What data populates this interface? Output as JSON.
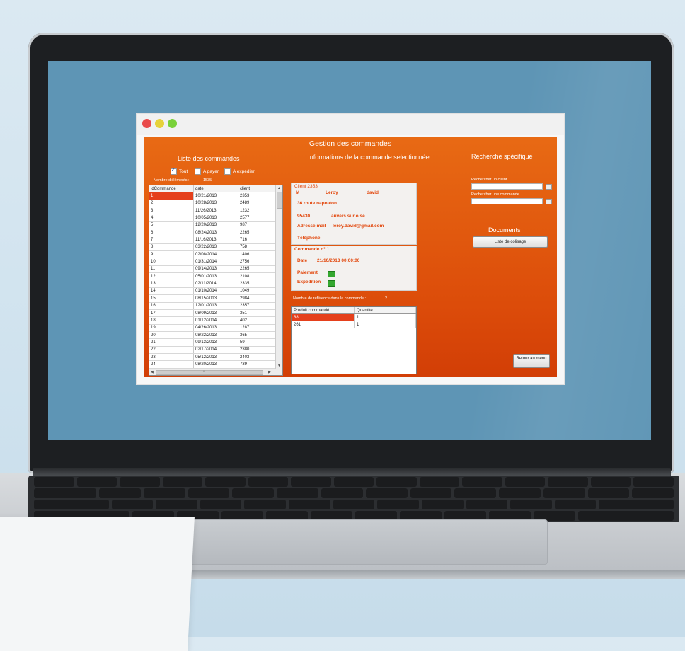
{
  "window": {
    "dots": [
      "#e94b4b",
      "#e6d23a",
      "#79d13a"
    ]
  },
  "app": {
    "title": "Gestion des commandes",
    "orders_section_title": "Liste des commandes",
    "info_section_title": "Informations de la commande selectionnée",
    "search_section_title": "Recherche spécifique",
    "filters": [
      {
        "label": "Tout",
        "checked": true
      },
      {
        "label": "A payer",
        "checked": false
      },
      {
        "label": "A expédier",
        "checked": false
      }
    ],
    "count_label": "Nombre d'éléments :",
    "count_value": "1535",
    "orders_table": {
      "columns": [
        "idCommande",
        "date",
        "client"
      ],
      "rows": [
        [
          "1",
          "10/21/2013",
          "2353"
        ],
        [
          "2",
          "10/28/2013",
          "2489"
        ],
        [
          "3",
          "11/26/2013",
          "1232"
        ],
        [
          "4",
          "10/05/2013",
          "2577"
        ],
        [
          "5",
          "12/20/2013",
          "987"
        ],
        [
          "6",
          "08/24/2013",
          "2265"
        ],
        [
          "7",
          "11/16/2013",
          "716"
        ],
        [
          "8",
          "03/22/2013",
          "758"
        ],
        [
          "9",
          "02/08/2014",
          "1406"
        ],
        [
          "10",
          "01/31/2014",
          "2756"
        ],
        [
          "11",
          "09/14/2013",
          "2265"
        ],
        [
          "12",
          "05/01/2013",
          "2108"
        ],
        [
          "13",
          "02/11/2014",
          "2335"
        ],
        [
          "14",
          "01/10/2014",
          "1049"
        ],
        [
          "15",
          "08/15/2013",
          "2984"
        ],
        [
          "16",
          "12/01/2013",
          "2357"
        ],
        [
          "17",
          "08/09/2013",
          "351"
        ],
        [
          "18",
          "01/12/2014",
          "402"
        ],
        [
          "19",
          "04/26/2013",
          "1287"
        ],
        [
          "20",
          "08/22/2013",
          "365"
        ],
        [
          "21",
          "09/13/2013",
          "59"
        ],
        [
          "22",
          "02/17/2014",
          "2380"
        ],
        [
          "23",
          "05/12/2013",
          "2403"
        ],
        [
          "24",
          "08/20/2013",
          "739"
        ]
      ],
      "selected_row": 0
    },
    "client_box": {
      "header": "Client 2353",
      "civility": "M",
      "last_name": "Leroy",
      "first_name": "david",
      "address": "36 route napoléon",
      "postal_code": "95430",
      "city": "auvers sur oise",
      "email_label": "Adresse mail",
      "email": "leroy.david@gmail.com",
      "phone_label": "Téléphone"
    },
    "order_box": {
      "header": "Commande n° 1",
      "date_label": "Date",
      "date_value": "21/10/2013 00:00:00",
      "payment_label": "Paiement",
      "shipping_label": "Expedition"
    },
    "ref_count_label": "Nombre de référence dans la commande :",
    "ref_count_value": "2",
    "products_table": {
      "columns": [
        "Produit commandé",
        "Quantité"
      ],
      "rows": [
        [
          "88",
          "1"
        ],
        [
          "261",
          "1"
        ]
      ],
      "selected_row": 0
    },
    "search_client_label": "Rechercher un client",
    "search_order_label": "Rechercher une commande",
    "documents_title": "Documents",
    "packing_list_button": "Liste de colisage",
    "back_button": "Retour au menu",
    "scroll_thumb_grip": "III"
  },
  "colors": {
    "panel_orange": "#e0550c",
    "selection_red": "#e5401c",
    "status_green": "#34a72f"
  }
}
